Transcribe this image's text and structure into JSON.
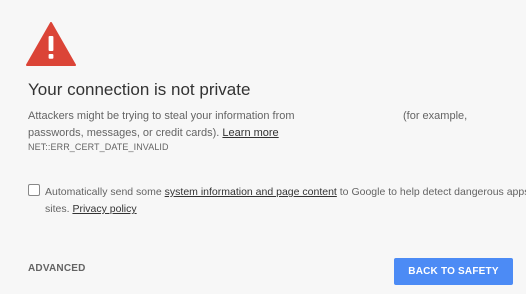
{
  "heading": "Your connection is not private",
  "message": {
    "before_domain": "Attackers might be trying to steal your information from",
    "after_domain": "(for example,",
    "line2_text": "passwords, messages, or credit cards).",
    "learn_more": "Learn more"
  },
  "error_code": "NET::ERR_CERT_DATE_INVALID",
  "optin": {
    "checked": false,
    "prefix": "Automatically send some",
    "link": "system information and page content",
    "suffix": "to Google to help detect dangerous apps and",
    "line2_prefix": "sites.",
    "privacy_link": "Privacy policy"
  },
  "buttons": {
    "advanced": "ADVANCED",
    "back_to_safety": "BACK TO SAFETY"
  },
  "icon": "warning-triangle-icon",
  "colors": {
    "background": "#f7f7f7",
    "warning_icon": "#db4437",
    "primary_button": "#4c8bf5",
    "text": "#333333",
    "secondary_text": "#646464"
  }
}
